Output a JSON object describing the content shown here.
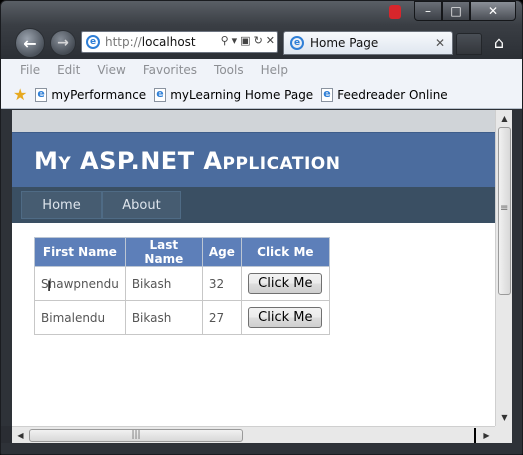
{
  "browser": {
    "address": {
      "prefix": "http://",
      "host": "localhost"
    },
    "tab": {
      "title": "Home Page",
      "close": "✕"
    },
    "caption": {
      "minimize": "–",
      "maximize": "□",
      "close": "✕"
    },
    "menu": [
      "File",
      "Edit",
      "View",
      "Favorites",
      "Tools",
      "Help"
    ],
    "favorites": [
      "myPerformance",
      "myLearning Home Page",
      "Feedreader Online"
    ]
  },
  "page": {
    "header_title": "My ASP.NET Application",
    "nav": [
      "Home",
      "About"
    ],
    "grid": {
      "columns": [
        "First Name",
        "Last Name",
        "Age",
        "Click Me"
      ],
      "rows": [
        {
          "first": "Shawpnendu",
          "last": "Bikash",
          "age": "32",
          "button": "Click Me"
        },
        {
          "first": "Bimalendu",
          "last": "Bikash",
          "age": "27",
          "button": "Click Me"
        }
      ]
    }
  },
  "colors": {
    "header_bg": "#4b6c9e",
    "nav_bg": "#3a4f63",
    "grid_header_bg": "#5d7fb9"
  }
}
